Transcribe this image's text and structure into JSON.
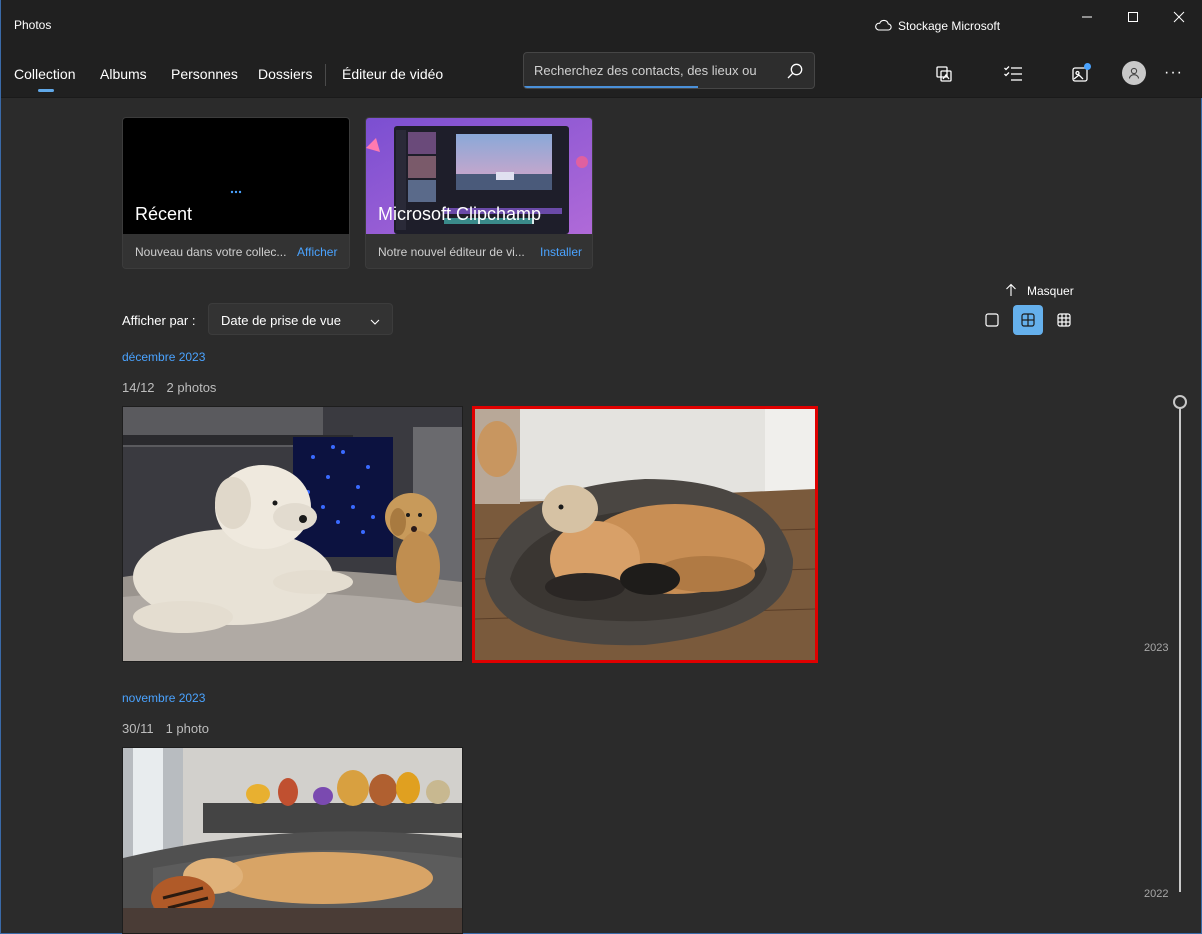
{
  "window": {
    "title": "Photos",
    "storage_label": "Stockage Microsoft"
  },
  "nav": {
    "tabs": [
      {
        "label": "Collection",
        "active": true
      },
      {
        "label": "Albums"
      },
      {
        "label": "Personnes"
      },
      {
        "label": "Dossiers"
      },
      {
        "label": "Éditeur de vidéo"
      }
    ],
    "search_placeholder": "Recherchez des contacts, des lieux ou",
    "icons": [
      "import-icon",
      "select-icon",
      "whats-new-icon",
      "account-icon",
      "more-icon"
    ],
    "more_label": "···"
  },
  "cards": [
    {
      "title": "Récent",
      "desc": "Nouveau dans votre collec...",
      "action": "Afficher"
    },
    {
      "title": "Microsoft Clipchamp",
      "desc": "Notre nouvel éditeur de vi...",
      "action": "Installer"
    }
  ],
  "toolbar": {
    "hide_label": "Masquer",
    "sort_label": "Afficher par :",
    "sort_value": "Date de prise de vue",
    "view_modes": [
      "single-view",
      "medium-grid",
      "small-grid"
    ],
    "active_view": "medium-grid"
  },
  "groups": [
    {
      "month": "décembre 2023",
      "days": [
        {
          "date": "14/12",
          "count": "2 photos",
          "photos": [
            "dog-on-rug",
            "dog-in-bed"
          ],
          "selected": "dog-in-bed"
        }
      ]
    },
    {
      "month": "novembre 2023",
      "days": [
        {
          "date": "30/11",
          "count": "1 photo",
          "photos": [
            "dog-on-sofa"
          ]
        }
      ]
    }
  ],
  "timeline": {
    "years": [
      "2023",
      "2022"
    ]
  },
  "colors": {
    "accent": "#4aa3ff",
    "background": "#2b2b2b",
    "selection": "#e00000"
  }
}
